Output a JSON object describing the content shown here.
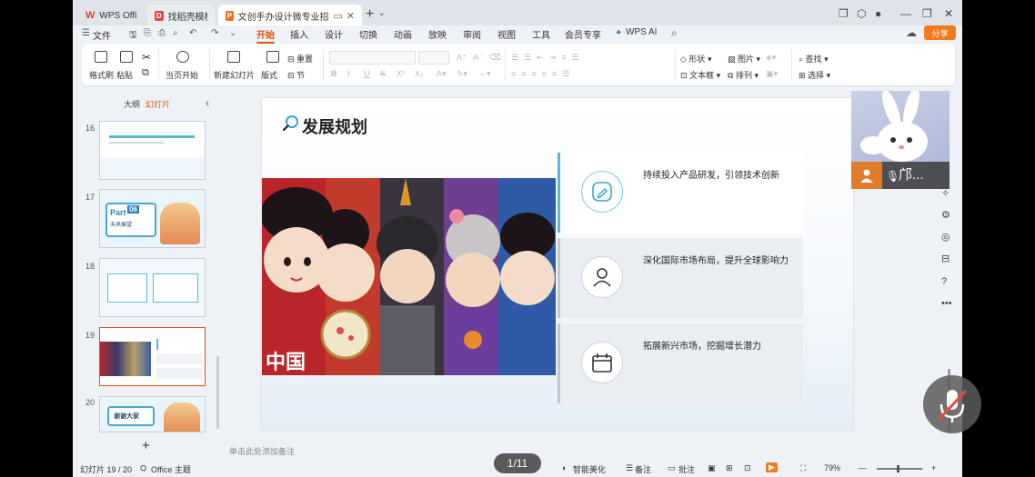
{
  "app": {
    "tabs": [
      {
        "label": "WPS Office",
        "icon": "wps-logo-icon"
      },
      {
        "label": "找稻壳模板",
        "icon": "docer-icon"
      },
      {
        "label": "文创手办设计微专业招生宣讲",
        "icon": "presentation-file-icon"
      }
    ]
  },
  "menu": {
    "file": "文件",
    "items": [
      "开始",
      "插入",
      "设计",
      "切换",
      "动画",
      "放映",
      "审阅",
      "视图",
      "工具",
      "会员专享"
    ],
    "wps_ai": "WPS AI",
    "share": "分享"
  },
  "ribbon": {
    "format_painter": "格式刷",
    "paste": "粘贴",
    "from_current": "当页开始",
    "new_slide": "新建幻灯片",
    "layout": "版式",
    "reset": "重置",
    "section": "节",
    "shape": "形状",
    "picture": "图片",
    "textbox": "文本框",
    "arrange": "排列",
    "find": "查找",
    "select": "选择"
  },
  "left_panel": {
    "tab_outline": "大纲",
    "tab_slides": "幻灯片",
    "thumbs": [
      {
        "num": "16"
      },
      {
        "num": "17",
        "part": "Part",
        "part_no": "06",
        "caption": "未来展望"
      },
      {
        "num": "18"
      },
      {
        "num": "19"
      },
      {
        "num": "20",
        "caption": "谢谢大家"
      }
    ]
  },
  "slide": {
    "title": "发展规划",
    "cards": [
      {
        "text": "持续投入产品研发，引领技术创新",
        "icon": "pencil-circle-icon"
      },
      {
        "text": "深化国际市场布局，提升全球影响力",
        "icon": "user-icon"
      },
      {
        "text": "拓展新兴市场，挖掘增长潜力",
        "icon": "calendar-icon"
      }
    ],
    "photo_caption": "中国"
  },
  "notes_placeholder": "单击此处添加备注",
  "page_indicator": "1/11",
  "status": {
    "slide_count": "幻灯片 19 / 20",
    "theme": "Office 主题",
    "smart_beautify": "智能美化",
    "notes": "备注",
    "comment": "批注",
    "zoom": "79%"
  },
  "overlay": {
    "participant_name": "邝..."
  },
  "colors": {
    "accent": "#e1520e",
    "share_bg": "#f27a1a",
    "card_accent": "#5cb6dc"
  }
}
